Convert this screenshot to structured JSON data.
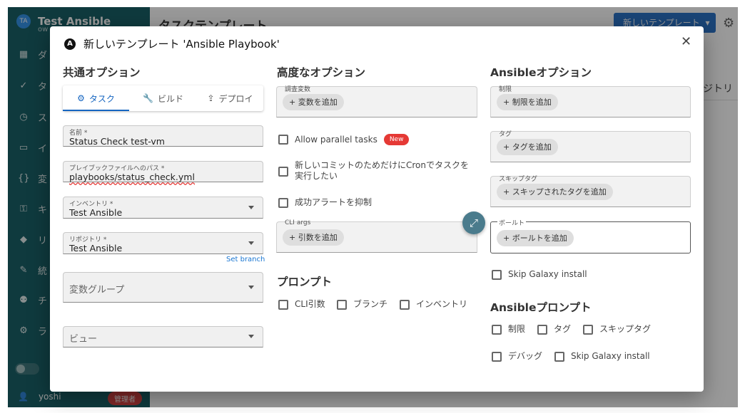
{
  "app": {
    "project_initials": "TA",
    "project_name": "Test Ansible",
    "project_sub": "ow",
    "page_title": "タスクテンプレート",
    "new_template_button": "新しいテンプレート",
    "column_repo_fragment": "ジトリ",
    "sidebar_items": [
      {
        "icon": "dashboard-icon",
        "glyph": "▦",
        "label": "ダ"
      },
      {
        "icon": "check-icon",
        "glyph": "✓",
        "label": "タ"
      },
      {
        "icon": "clock-icon",
        "glyph": "◷",
        "label": "ス"
      },
      {
        "icon": "monitor-icon",
        "glyph": "▭",
        "label": "イ"
      },
      {
        "icon": "braces-icon",
        "glyph": "{}",
        "label": "変"
      },
      {
        "icon": "key-icon",
        "glyph": "⚿",
        "label": "キ"
      },
      {
        "icon": "git-icon",
        "glyph": "◆",
        "label": "リ"
      },
      {
        "icon": "plug-icon",
        "glyph": "✎",
        "label": "統"
      },
      {
        "icon": "people-icon",
        "glyph": "⚉",
        "label": "チ"
      },
      {
        "icon": "gears-icon",
        "glyph": "⚙",
        "label": "ラ"
      }
    ],
    "user_name": "yoshi",
    "user_badge": "管理者"
  },
  "dialog": {
    "title": "新しいテンプレート 'Ansible Playbook'",
    "close_glyph": "✕",
    "common": {
      "heading": "共通オプション",
      "tabs": [
        {
          "label": "タスク",
          "glyph": "⚙"
        },
        {
          "label": "ビルド",
          "glyph": "🔧"
        },
        {
          "label": "デプロイ",
          "glyph": "⇪"
        }
      ],
      "name_label": "名前 *",
      "name_value": "Status Check test-vm",
      "playbook_label": "プレイブックファイルへのパス *",
      "playbook_value": "playbooks/status_check.yml",
      "inventory_label": "インベントリ *",
      "inventory_value": "Test Ansible",
      "repo_label": "リポジトリ *",
      "repo_value": "Test Ansible",
      "set_branch": "Set branch",
      "var_group_placeholder": "変数グループ",
      "view_placeholder": "ビュー"
    },
    "advanced": {
      "heading": "高度なオプション",
      "survey_label": "調査変数",
      "add_variable": "+ 変数を追加",
      "allow_parallel": "Allow parallel tasks",
      "new_badge": "New",
      "cron_only_line1": "新しいコミットのためだけにCronでタスクを",
      "cron_only_line2": "実行したい",
      "suppress_success": "成功アラートを抑制",
      "cli_args_label": "CLI args",
      "add_arg": "+ 引数を追加",
      "prompt_heading": "プロンプト",
      "prompt_cli": "CLI引数",
      "prompt_branch": "ブランチ",
      "prompt_inventory": "インベントリ"
    },
    "ansible": {
      "heading": "Ansibleオプション",
      "limit_label": "制限",
      "add_limit": "+ 制限を追加",
      "tags_label": "タグ",
      "add_tag": "+ タグを追加",
      "skip_tags_label": "スキップタグ",
      "add_skip_tag": "+ スキップされたタグを追加",
      "vault_label": "ボールト",
      "add_vault": "+ ボールトを追加",
      "skip_galaxy": "Skip Galaxy install",
      "prompt_heading": "Ansibleプロンプト",
      "prompt_limit": "制限",
      "prompt_tags": "タグ",
      "prompt_skip_tags": "スキップタグ",
      "prompt_debug": "デバッグ",
      "prompt_skip_galaxy": "Skip Galaxy install"
    }
  }
}
